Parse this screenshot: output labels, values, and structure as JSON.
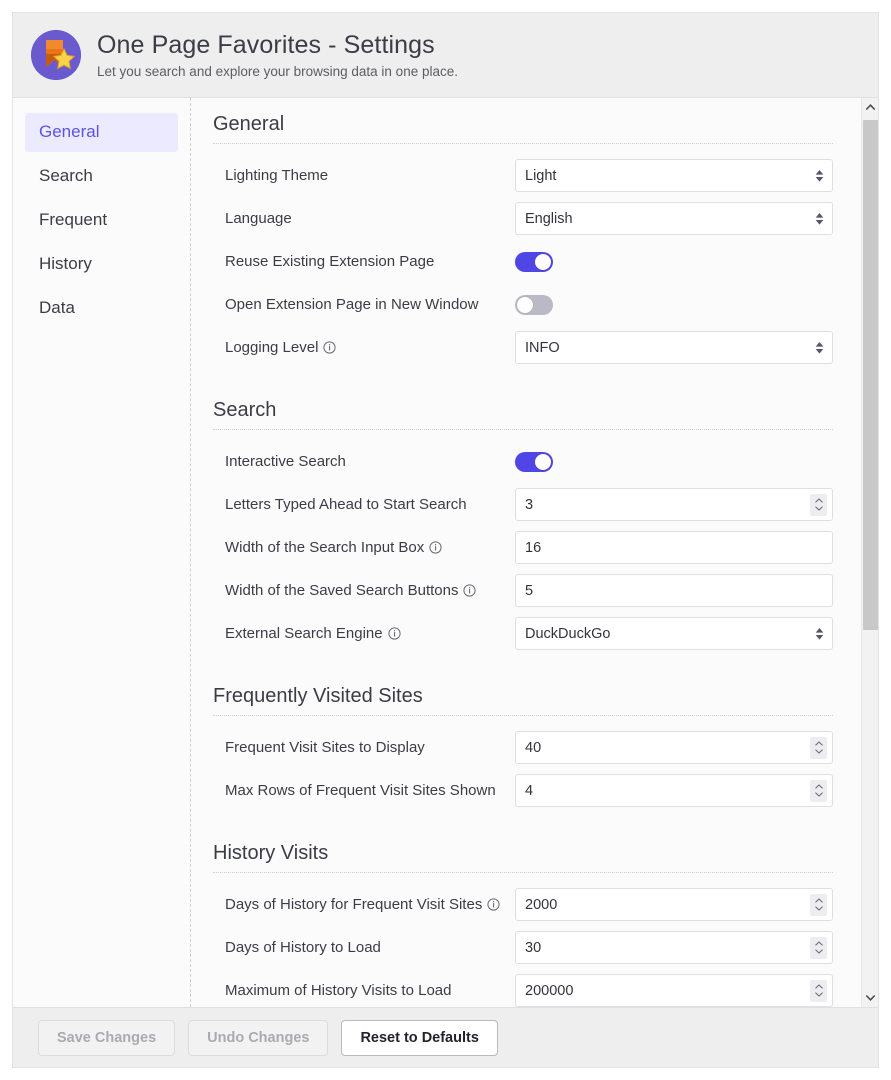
{
  "header": {
    "title": "One Page Favorites - Settings",
    "subtitle": "Let you search and explore your browsing data in one place.",
    "logo_icon": "bookmark-star-icon"
  },
  "colors": {
    "accent": "#4f46e5",
    "nav_active_text": "#5b54e0",
    "nav_active_bg": "#eceaff",
    "header_bg": "#eeeeee",
    "toggle_off": "#b9bac6",
    "logo_circle": "#6a5acd",
    "logo_ribbon": "#d2691e",
    "logo_star": "#ffd24a"
  },
  "sidebar": {
    "items": [
      {
        "label": "General",
        "active": true
      },
      {
        "label": "Search",
        "active": false
      },
      {
        "label": "Frequent",
        "active": false
      },
      {
        "label": "History",
        "active": false
      },
      {
        "label": "Data",
        "active": false
      }
    ]
  },
  "sections": [
    {
      "title": "General",
      "rows": [
        {
          "label": "Lighting Theme",
          "info": false,
          "type": "select",
          "value": "Light"
        },
        {
          "label": "Language",
          "info": false,
          "type": "select",
          "value": "English"
        },
        {
          "label": "Reuse Existing Extension Page",
          "info": false,
          "type": "toggle",
          "value": "on"
        },
        {
          "label": "Open Extension Page in New Window",
          "info": false,
          "type": "toggle",
          "value": "off"
        },
        {
          "label": "Logging Level",
          "info": true,
          "type": "select",
          "value": "INFO"
        }
      ]
    },
    {
      "title": "Search",
      "rows": [
        {
          "label": "Interactive Search",
          "info": false,
          "type": "toggle",
          "value": "on"
        },
        {
          "label": "Letters Typed Ahead to Start Search",
          "info": false,
          "type": "number",
          "value": "3"
        },
        {
          "label": "Width of the Search Input Box",
          "info": true,
          "type": "text",
          "value": "16"
        },
        {
          "label": "Width of the Saved Search Buttons",
          "info": true,
          "type": "text",
          "value": "5"
        },
        {
          "label": "External Search Engine",
          "info": true,
          "type": "select",
          "value": "DuckDuckGo"
        }
      ]
    },
    {
      "title": "Frequently Visited Sites",
      "rows": [
        {
          "label": "Frequent Visit Sites to Display",
          "info": false,
          "type": "number",
          "value": "40"
        },
        {
          "label": "Max Rows of Frequent Visit Sites Shown",
          "info": false,
          "type": "number",
          "value": "4"
        }
      ]
    },
    {
      "title": "History Visits",
      "rows": [
        {
          "label": "Days of History for Frequent Visit Sites",
          "info": true,
          "type": "number",
          "value": "2000"
        },
        {
          "label": "Days of History to Load",
          "info": false,
          "type": "number",
          "value": "30"
        },
        {
          "label": "Maximum of History Visits to Load",
          "info": false,
          "type": "number",
          "value": "200000"
        }
      ]
    }
  ],
  "scrollbar": {
    "up_icon": "chevron-up-icon",
    "down_icon": "chevron-down-icon"
  },
  "footer": {
    "buttons": [
      {
        "label": "Save Changes",
        "state": "disabled"
      },
      {
        "label": "Undo Changes",
        "state": "disabled"
      },
      {
        "label": "Reset to Defaults",
        "state": "enabled"
      }
    ]
  }
}
